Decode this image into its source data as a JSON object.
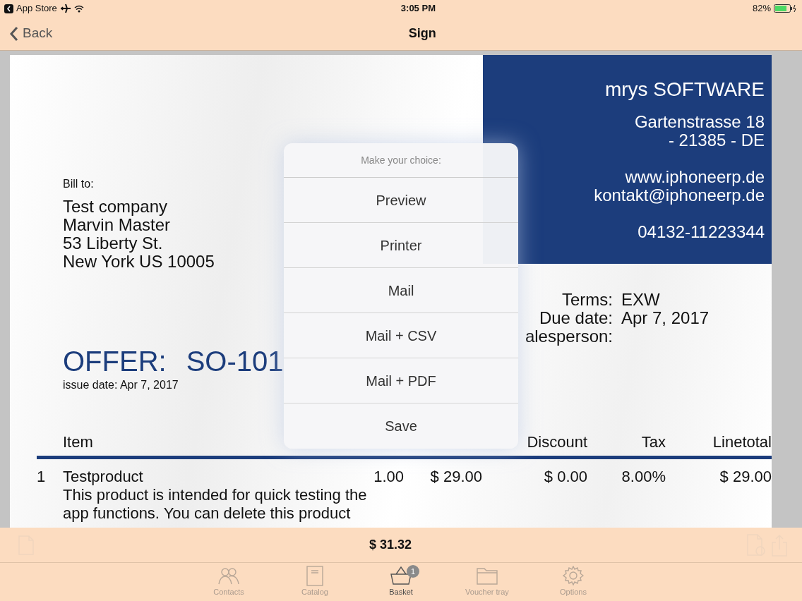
{
  "status_bar": {
    "carrier": "App Store",
    "time": "3:05 PM",
    "battery": "82%"
  },
  "nav": {
    "back": "Back",
    "title": "Sign"
  },
  "document": {
    "company": {
      "name": "mrys SOFTWARE",
      "address": [
        "Gartenstrasse 18",
        "- 21385 - DE"
      ],
      "contact": [
        "www.iphoneerp.de",
        "kontakt@iphoneerp.de"
      ],
      "phone": "04132-11223344"
    },
    "bill_to": {
      "label": "Bill to:",
      "lines": [
        "Test company",
        "Marvin Master",
        "53 Liberty St.",
        "New York US 10005"
      ]
    },
    "terms": [
      {
        "label": "Terms:",
        "value": "EXW"
      },
      {
        "label": "Due date:",
        "value": "Apr 7, 2017"
      },
      {
        "label": "alesperson:"
      }
    ],
    "offer": {
      "label": "OFFER:",
      "number": "SO-101",
      "issue_date": "issue date: Apr 7, 2017"
    },
    "table": {
      "columns": [
        {
          "label": "Item",
          "kind": "item"
        },
        {
          "label": "Discount",
          "kind": "discount"
        },
        {
          "label": "Tax",
          "kind": "tax"
        },
        {
          "label": "Linetotal",
          "kind": "linetotal"
        }
      ],
      "rows": [
        {
          "number": "1",
          "name": "Testproduct",
          "description": "This product is intended for quick testing the app functions. You can delete this product",
          "quantity": "1.00",
          "price": "$ 29.00",
          "discount": "$ 0.00",
          "tax": "8.00%",
          "linetotal": "$ 29.00"
        }
      ]
    }
  },
  "action_sheet": {
    "title": "Make your choice:",
    "options": [
      "Preview",
      "Printer",
      "Mail",
      "Mail + CSV",
      "Mail + PDF",
      "Save"
    ]
  },
  "total": "$ 31.32",
  "tabs": [
    {
      "label": "Contacts",
      "kind": "contacts",
      "selected": false
    },
    {
      "label": "Catalog",
      "kind": "catalog",
      "selected": false
    },
    {
      "label": "Basket",
      "kind": "basket",
      "selected": true,
      "badge": "1"
    },
    {
      "label": "Voucher tray",
      "kind": "folder",
      "selected": false
    },
    {
      "label": "Options",
      "kind": "gear",
      "selected": false
    }
  ]
}
